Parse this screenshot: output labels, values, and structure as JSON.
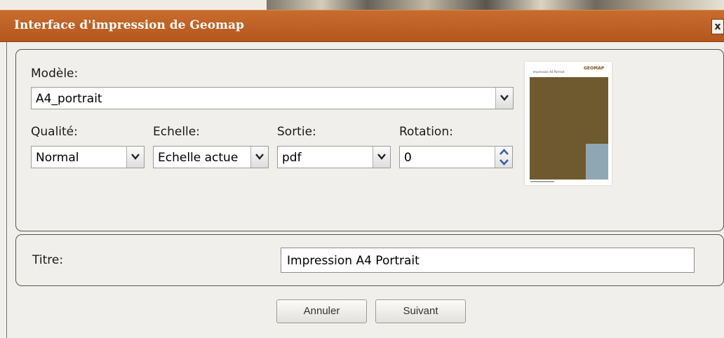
{
  "window": {
    "title": "Interface d'impression de Geomap",
    "close_glyph": "x"
  },
  "form": {
    "modele": {
      "label": "Modèle:",
      "value": "A4_portrait"
    },
    "qualite": {
      "label": "Qualité:",
      "value": "Normal"
    },
    "echelle": {
      "label": "Echelle:",
      "value": "Echelle actue"
    },
    "sortie": {
      "label": "Sortie:",
      "value": "pdf"
    },
    "rotation": {
      "label": "Rotation:",
      "value": "0"
    },
    "titre": {
      "label": "Titre:",
      "value": "Impression A4 Portrait"
    }
  },
  "preview": {
    "title": "Impression A4 Portrait",
    "logo": "GEOMAP",
    "icon": "page-thumbnail"
  },
  "buttons": {
    "cancel": "Annuler",
    "next": "Suivant"
  },
  "colors": {
    "titlebar": "#b4571d",
    "map": "#6e5a2e",
    "inset": "#8fa7b2",
    "arrow": "#3a5f9e"
  }
}
